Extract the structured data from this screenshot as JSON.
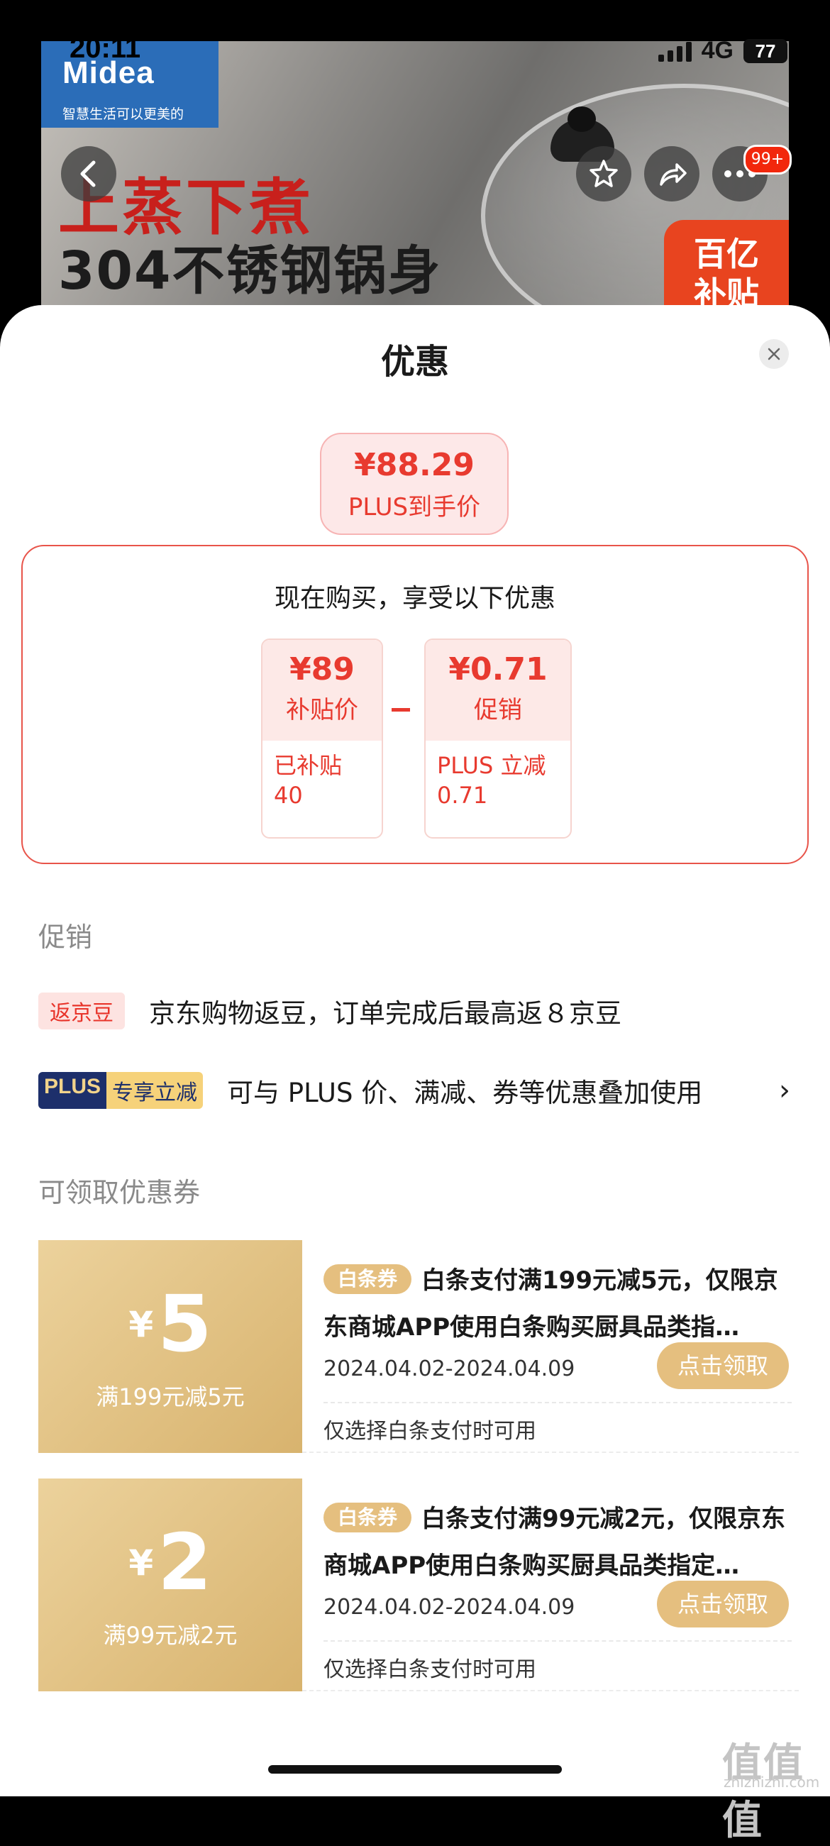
{
  "status_bar": {
    "time": "20:11",
    "network": "4G",
    "battery": "77"
  },
  "hero": {
    "brand": "Midea",
    "slogan": "智慧生活可以更美的",
    "headline_1": "上蒸下煮",
    "headline_2": "304不锈钢锅身",
    "badge_line1": "百亿",
    "badge_line2": "补贴",
    "notification_count": "99+"
  },
  "sheet": {
    "title": "优惠",
    "price": "¥88.29",
    "price_label": "PLUS到手价",
    "deal_heading": "现在购买，享受以下优惠",
    "deals": [
      {
        "value": "¥89",
        "label": "补贴价",
        "detail": "已补贴\n40"
      },
      {
        "value": "¥0.71",
        "label": "促销",
        "detail": "PLUS 立减\n0.71"
      }
    ]
  },
  "promotions": {
    "section_title": "促销",
    "items": [
      {
        "tag": "返京豆",
        "text": "京东购物返豆，订单完成后最高返８京豆"
      },
      {
        "tag_a": "PLUS",
        "tag_b": "专享立减",
        "text": "可与 PLUS 价、满减、券等优惠叠加使用"
      }
    ]
  },
  "coupons": {
    "section_title": "可领取优惠券",
    "items": [
      {
        "currency": "¥",
        "amount": "5",
        "condition": "满199元减5元",
        "tag": "白条券",
        "title": "白条支付满199元减5元，仅限京东商城APP使用白条购买厨具品类指…",
        "date": "2024.04.02-2024.04.09",
        "button": "点击领取",
        "note": "仅选择白条支付时可用"
      },
      {
        "currency": "¥",
        "amount": "2",
        "condition": "满99元减2元",
        "tag": "白条券",
        "title": "白条支付满99元减2元，仅限京东商城APP使用白条购买厨具品类指定…",
        "date": "2024.04.02-2024.04.09",
        "button": "点击领取",
        "note": "仅选择白条支付时可用"
      }
    ]
  },
  "watermark": {
    "main": "值值值",
    "sub": "zhizhizhi.com"
  },
  "colors": {
    "accent_red": "#e83a2f",
    "gold": "#e5bf7f",
    "plus_navy": "#1d2f6b"
  }
}
